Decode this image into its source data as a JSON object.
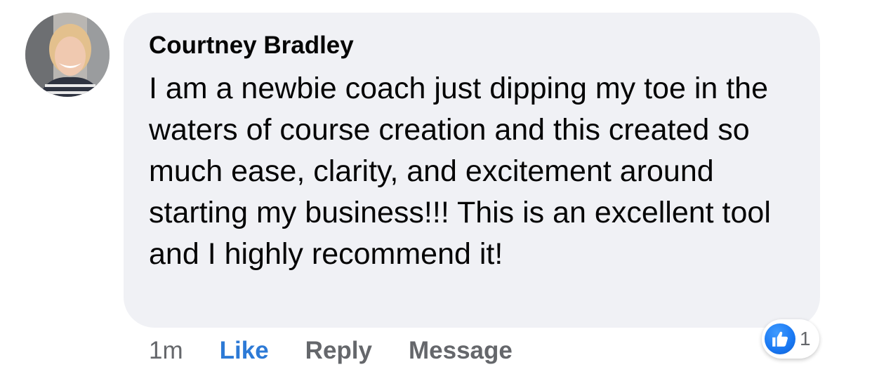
{
  "comment": {
    "author": "Courtney Bradley",
    "text": "I am a newbie coach just dipping my toe in the waters of course creation and this created so much ease, clarity, and excitement around starting my business!!! This is an excellent tool and I highly recommend it!",
    "avatar_icon": "profile-photo"
  },
  "actions": {
    "timestamp": "1m",
    "like_label": "Like",
    "reply_label": "Reply",
    "message_label": "Message"
  },
  "reactions": {
    "icon": "thumbs-up-icon",
    "count": "1"
  },
  "colors": {
    "bubble": "#f0f1f5",
    "like_active": "#2d7ad6",
    "secondary_text": "#65676b",
    "reaction_badge": "#1877f2"
  }
}
